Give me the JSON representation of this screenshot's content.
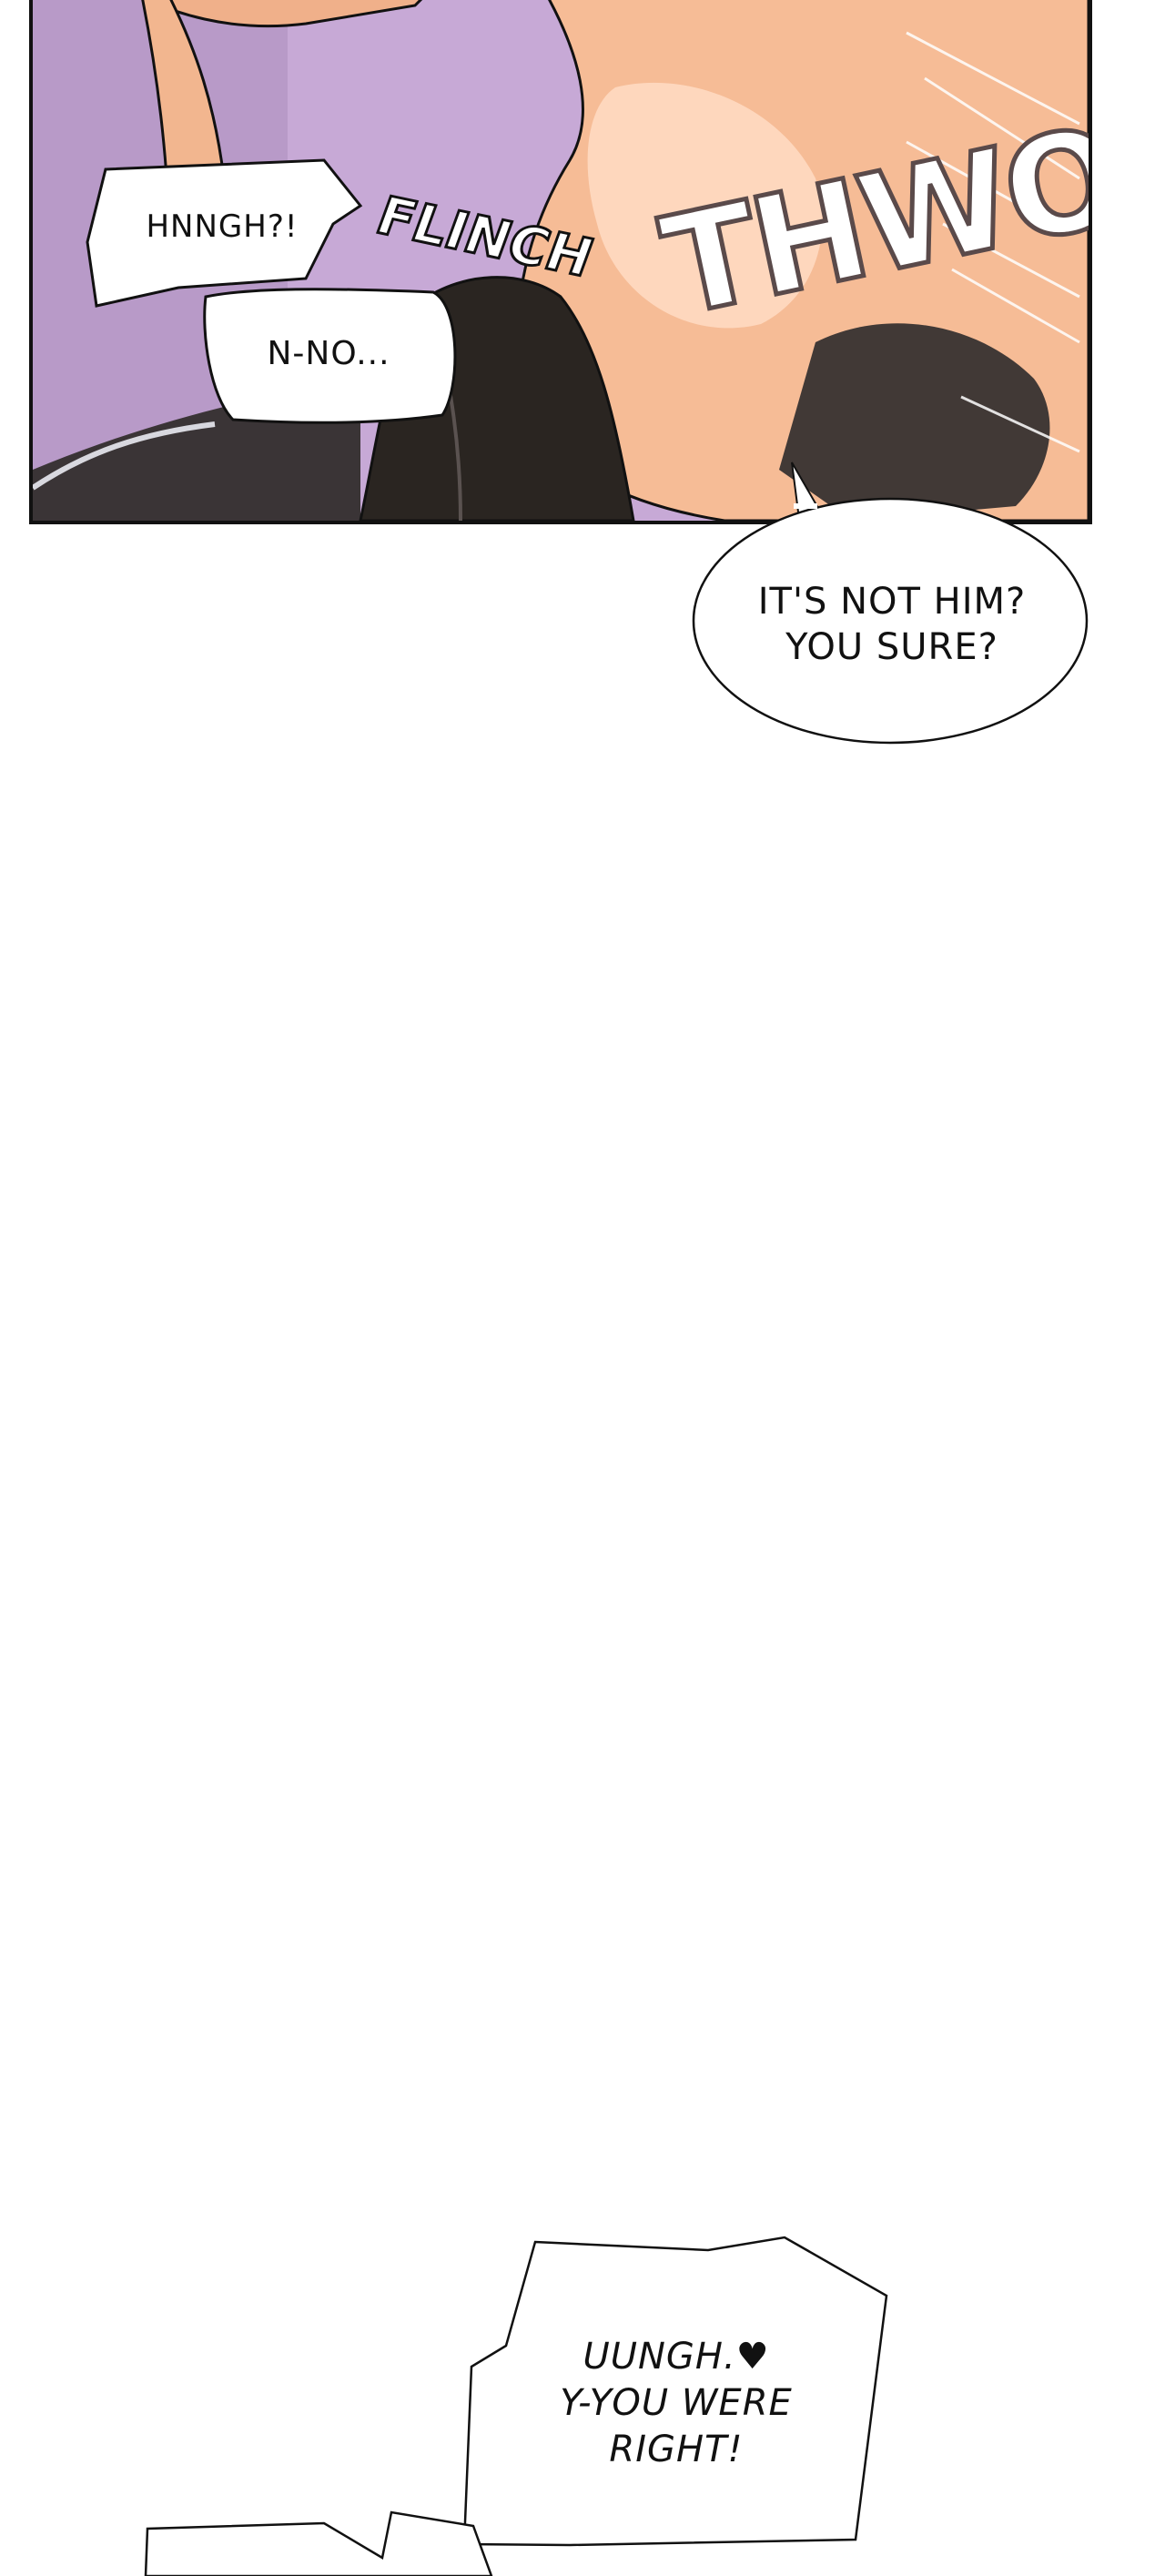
{
  "panel": {
    "colors": {
      "background": "#c7a9d6",
      "skin": "#f4b78f",
      "skin_light": "#ffd9bf",
      "clothing": "#2a2521",
      "border": "#111111"
    }
  },
  "sound_effects": {
    "flinch": "FLINCH",
    "thwop": "THWOP"
  },
  "bubbles": {
    "hnngh": "HNNGH?!",
    "nno": "N-NO...",
    "not_him": {
      "line1": "IT'S NOT HIM?",
      "line2": "YOU SURE?"
    },
    "uungh": {
      "line1": "UUNGH.♥",
      "line2": "Y-YOU WERE",
      "line3": "RIGHT!"
    }
  }
}
